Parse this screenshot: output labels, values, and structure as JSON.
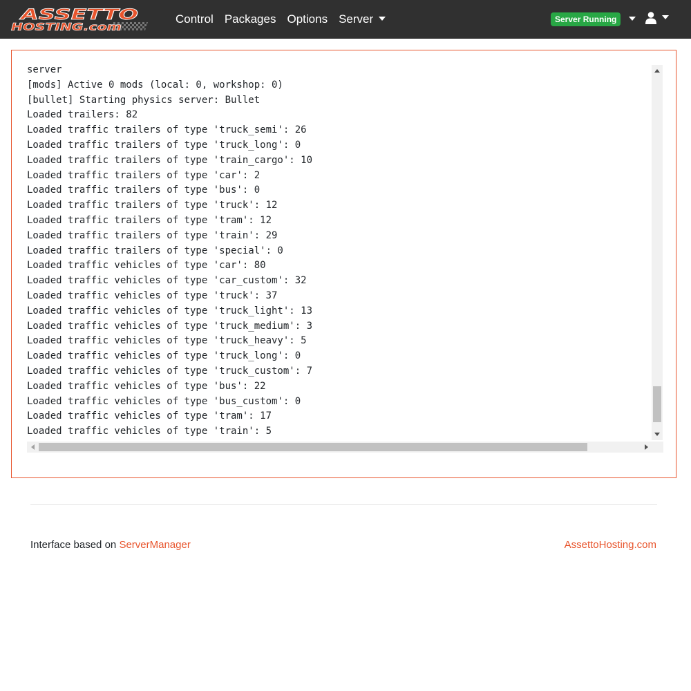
{
  "brand": {
    "logo_line1": "ASSETTO",
    "logo_line2": "HOSTING.com"
  },
  "nav": {
    "items": [
      {
        "label": "Control"
      },
      {
        "label": "Packages"
      },
      {
        "label": "Options"
      },
      {
        "label": "Server",
        "dropdown": true
      }
    ]
  },
  "status": {
    "badge": "Server Running",
    "color": "#28a745"
  },
  "user_menu": {
    "icon": "user-icon"
  },
  "console": {
    "lines": [
      "server",
      "[mods] Active 0 mods (local: 0, workshop: 0)",
      "[bullet] Starting physics server: Bullet",
      "Loaded trailers: 82",
      "Loaded traffic trailers of type 'truck_semi': 26",
      "Loaded traffic trailers of type 'truck_long': 0",
      "Loaded traffic trailers of type 'train_cargo': 10",
      "Loaded traffic trailers of type 'car': 2",
      "Loaded traffic trailers of type 'bus': 0",
      "Loaded traffic trailers of type 'truck': 12",
      "Loaded traffic trailers of type 'tram': 12",
      "Loaded traffic trailers of type 'train': 29",
      "Loaded traffic trailers of type 'special': 0",
      "Loaded traffic vehicles of type 'car': 80",
      "Loaded traffic vehicles of type 'car_custom': 32",
      "Loaded traffic vehicles of type 'truck': 37",
      "Loaded traffic vehicles of type 'truck_light': 13",
      "Loaded traffic vehicles of type 'truck_medium': 3",
      "Loaded traffic vehicles of type 'truck_heavy': 5",
      "Loaded traffic vehicles of type 'truck_long': 0",
      "Loaded traffic vehicles of type 'truck_custom': 7",
      "Loaded traffic vehicles of type 'bus': 22",
      "Loaded traffic vehicles of type 'bus_custom': 0",
      "Loaded traffic vehicles of type 'tram': 17",
      "Loaded traffic vehicles of type 'train': 5"
    ]
  },
  "footer": {
    "prefix": "Interface based on ",
    "link": "ServerManager",
    "right_link": "AssettoHosting.com"
  },
  "colors": {
    "navbar": "#303030",
    "accent": "#e8542c"
  }
}
